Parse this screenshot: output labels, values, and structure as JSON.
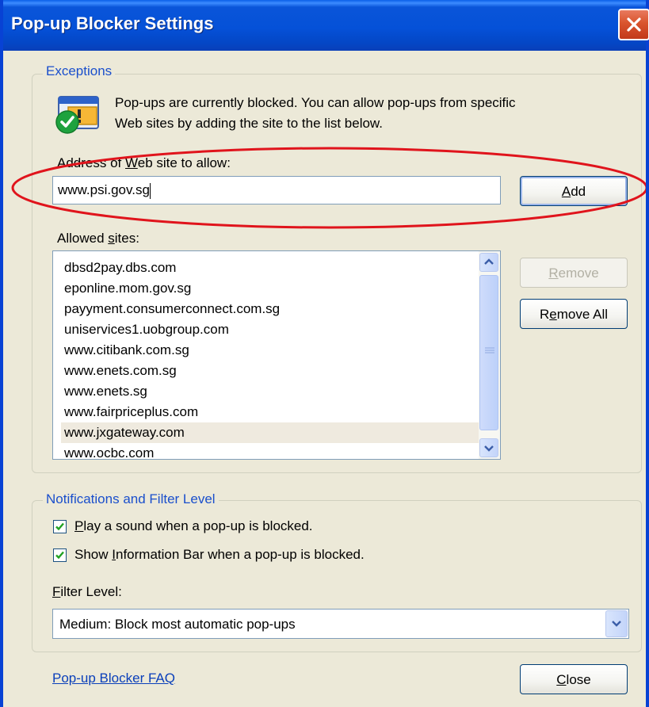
{
  "window": {
    "title": "Pop-up Blocker Settings"
  },
  "exceptions": {
    "legend": "Exceptions",
    "info_line1": "Pop-ups are currently blocked.  You can allow pop-ups from specific",
    "info_line2": "Web sites by adding the site to the list below.",
    "address_label_prefix": "Address of ",
    "address_label_hotkey": "W",
    "address_label_suffix": "eb site to allow:",
    "address_value": "www.psi.gov.sg",
    "add_hotkey": "A",
    "add_rest": "dd",
    "allowed_label_prefix": "Allowed ",
    "allowed_label_hotkey": "s",
    "allowed_label_suffix": "ites:",
    "allowed_sites": [
      "dbsd2pay.dbs.com",
      "eponline.mom.gov.sg",
      "payyment.consumerconnect.com.sg",
      "uniservices1.uobgroup.com",
      "www.citibank.com.sg",
      "www.enets.com.sg",
      "www.enets.sg",
      "www.fairpriceplus.com",
      "www.jxgateway.com",
      "www.ocbc.com"
    ],
    "remove_hotkey": "R",
    "remove_rest": "emove",
    "remove_all_hotkey": "e",
    "remove_all_prefix": "R",
    "remove_all_suffix": "move All"
  },
  "notifications": {
    "legend": "Notifications and Filter Level",
    "play_sound_hotkey": "P",
    "play_sound_rest": "lay a sound when a pop-up is blocked.",
    "play_sound_checked": true,
    "info_bar_prefix": "Show ",
    "info_bar_hotkey": "I",
    "info_bar_suffix": "nformation Bar when a pop-up is blocked.",
    "info_bar_checked": true,
    "filter_label_hotkey": "F",
    "filter_label_rest": "ilter Level:",
    "filter_value": "Medium: Block most automatic pop-ups"
  },
  "footer": {
    "faq_link": "Pop-up Blocker FAQ",
    "close_hotkey": "C",
    "close_rest": "lose"
  },
  "colors": {
    "titlebar": "#0551d8",
    "close_button": "#d9542d",
    "legend_text": "#1a4fcc",
    "annotation_ellipse": "#e0141c",
    "checkmark": "#21a121"
  }
}
